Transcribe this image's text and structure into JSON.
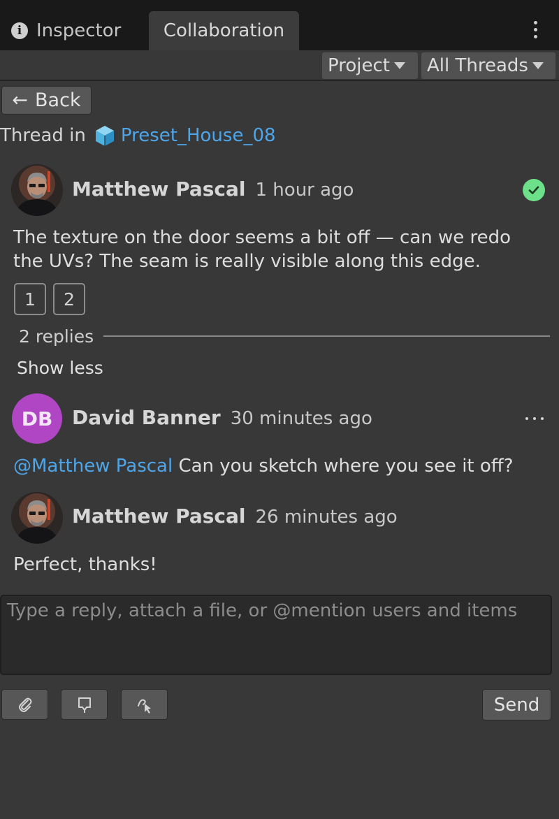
{
  "tabs": {
    "inspector": "Inspector",
    "collaboration": "Collaboration"
  },
  "toolbar": {
    "project_dropdown": "Project",
    "threads_dropdown": "All Threads"
  },
  "header": {
    "back_label": "Back",
    "thread_in_label": "Thread in",
    "asset_name": "Preset_House_08"
  },
  "thread": {
    "author": "Matthew Pascal",
    "time": "1 hour ago",
    "status": "resolved",
    "body": "The texture on the door seems a bit off — can we redo the UVs? The seam is really visible along this edge.",
    "attachments": [
      "1",
      "2"
    ],
    "replies_count_label": "2 replies",
    "show_less_label": "Show less"
  },
  "replies": [
    {
      "initials": "DB",
      "author": "David Banner",
      "time": "30 minutes ago",
      "mention": "@Matthew Pascal",
      "body": " Can you sketch where you see it off?"
    },
    {
      "author": "Matthew Pascal",
      "time": "26 minutes ago",
      "body": "Perfect, thanks!"
    }
  ],
  "composer": {
    "placeholder": "Type a reply, attach a file, or @mention users and items",
    "send_label": "Send",
    "tools": [
      "paperclip-icon",
      "annotation-pin-icon",
      "sketch-icon"
    ]
  },
  "colors": {
    "link": "#4ea6ea",
    "resolved": "#6de08a",
    "initials_avatar": "#b046c4"
  }
}
